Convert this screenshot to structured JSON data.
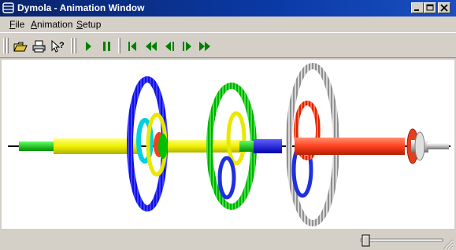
{
  "window": {
    "title": "Dymola - Animation Window",
    "app_icon": "dymola-icon",
    "title_bar_color": "#0a246a"
  },
  "caption_buttons": [
    {
      "name": "minimize-button",
      "icon": "minimize-icon"
    },
    {
      "name": "maximize-button",
      "icon": "maximize-icon"
    },
    {
      "name": "close-button",
      "icon": "close-icon"
    }
  ],
  "menu": {
    "file": {
      "mnemonic": "F",
      "rest": "ile"
    },
    "animation": {
      "mnemonic": "A",
      "rest": "nimation"
    },
    "setup": {
      "mnemonic": "S",
      "rest": "etup"
    }
  },
  "toolbar": {
    "file_buttons": [
      "open-icon",
      "print-icon",
      "whats-this-icon"
    ],
    "playback_buttons": [
      "play-icon",
      "pause-icon",
      "rewind-to-start-icon",
      "step-back-fast-icon",
      "step-back-icon",
      "step-forward-icon",
      "fast-forward-icon"
    ],
    "accent_color": "#008000"
  },
  "scene": {
    "description_colors": {
      "shaft": "#ffff00",
      "green_shaft": "#00c000",
      "blue": "#0000ff",
      "green_gear": "#00cc00",
      "red": "#ff4020",
      "gray": "#a0a0a0",
      "cyan": "#00c0c0"
    }
  },
  "status": {
    "speed_slider_position": 0.05
  }
}
